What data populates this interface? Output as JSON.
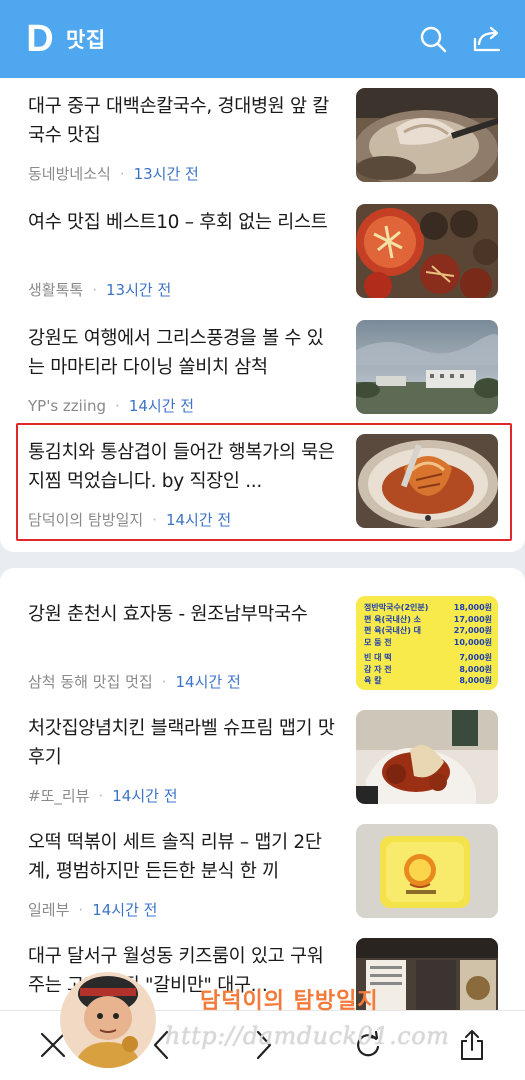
{
  "app": {
    "title": "맛집",
    "logo_letter": "D",
    "accent": "#4fa8ef"
  },
  "header": {
    "icons": [
      "search-icon",
      "share-icon"
    ]
  },
  "articles_group1": [
    {
      "title": "대구 중구 대백손칼국수, 경대병원 앞 칼국수 맛집",
      "source": "동네방네소식",
      "time": "13시간 전"
    },
    {
      "title": "여수 맛집 베스트10 – 후회 없는 리스트",
      "source": "생활톡톡",
      "time": "13시간 전"
    },
    {
      "title": "강원도 여행에서 그리스풍경을 볼 수 있는 마마티라 다이닝 쏠비치 삼척",
      "source": "YP's zziing",
      "time": "14시간 전"
    },
    {
      "title": "통김치와 통삼겹이 들어간 행복가의 묵은지찜 먹었습니다. by 직장인 ...",
      "source": "담덕이의 탐방일지",
      "time": "14시간 전"
    }
  ],
  "articles_group2": [
    {
      "title": "강원 춘천시 효자동 - 원조남부막국수",
      "source": "삼척 동해 맛집 멋집",
      "time": "14시간 전"
    },
    {
      "title": "처갓집양념치킨 블랙라벨 슈프림 맵기 맛 후기",
      "source": "#또_리뷰",
      "time": "14시간 전"
    },
    {
      "title": "오떡 떡볶이 세트 솔직 리뷰 – 맵기 2단계, 평범하지만 든든한 분식 한 끼",
      "source": "일레부",
      "time": "14시간 전"
    },
    {
      "title": "대구 달서구 월성동 키즈룸이 있고 구워주는 고기 맛집 \"갈비만\" 대구...",
      "source": "",
      "time": ""
    }
  ],
  "menu_sign": {
    "rows": [
      [
        "정반막국수(2인분)",
        "18,000원"
      ],
      [
        "편 육(국내산) 소",
        "17,000원"
      ],
      [
        "편 육(국내산) 대",
        "27,000원"
      ],
      [
        "모 둠 전",
        "10,000원"
      ],
      [
        "빈 대 떡",
        "7,000원"
      ],
      [
        "감 자 전",
        "8,000원"
      ],
      [
        "육 칼",
        "8,000원"
      ]
    ]
  },
  "watermark": {
    "title": "담덕이의 탐방일지",
    "url": "http://damduck01.com"
  },
  "highlight_color": "#e0282b"
}
